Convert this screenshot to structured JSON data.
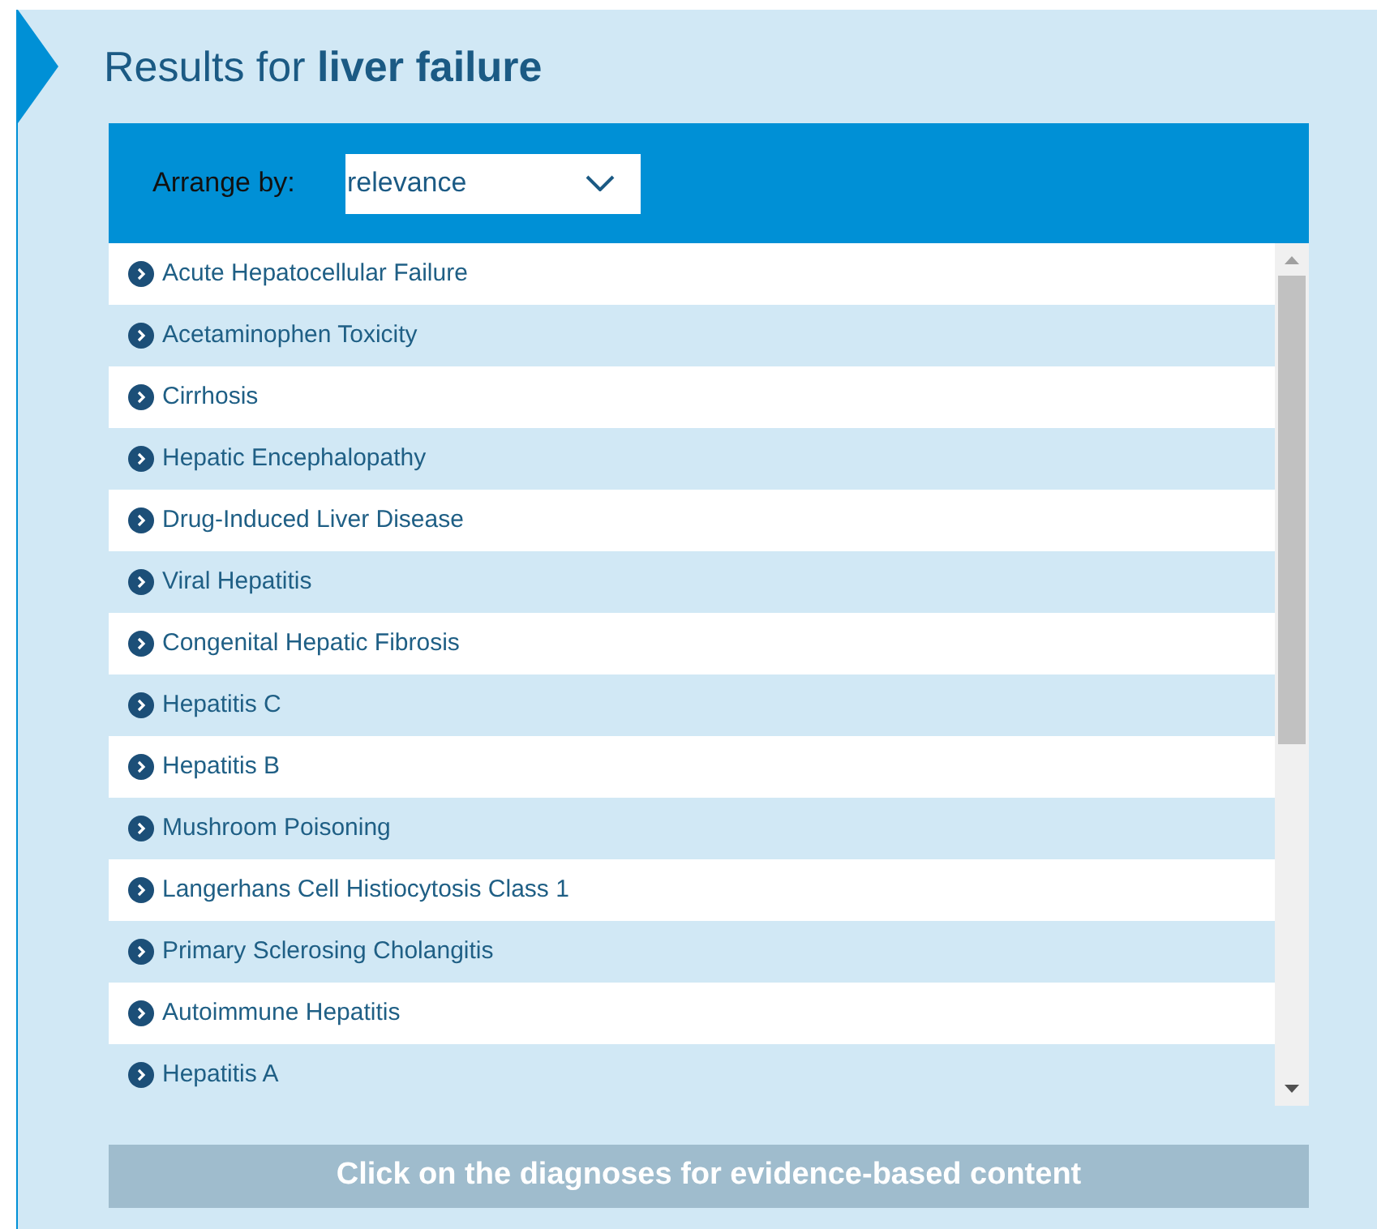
{
  "heading": "Results for **liver failure**",
  "arrange": {
    "label": "Arrange by:",
    "value": "relevance"
  },
  "results": [
    {
      "label": "Acute Hepatocellular Failure"
    },
    {
      "label": "Acetaminophen Toxicity"
    },
    {
      "label": "Cirrhosis"
    },
    {
      "label": "Hepatic Encephalopathy"
    },
    {
      "label": "Drug-Induced Liver Disease"
    },
    {
      "label": "Viral Hepatitis"
    },
    {
      "label": "Congenital Hepatic Fibrosis"
    },
    {
      "label": "Hepatitis C"
    },
    {
      "label": "Hepatitis B"
    },
    {
      "label": "Mushroom Poisoning"
    },
    {
      "label": "Langerhans Cell Histiocytosis Class 1"
    },
    {
      "label": "Primary Sclerosing Cholangitis"
    },
    {
      "label": "Autoimmune Hepatitis"
    },
    {
      "label": "Hepatitis A"
    }
  ],
  "footer": "Click on the diagnoses for evidence-based content"
}
